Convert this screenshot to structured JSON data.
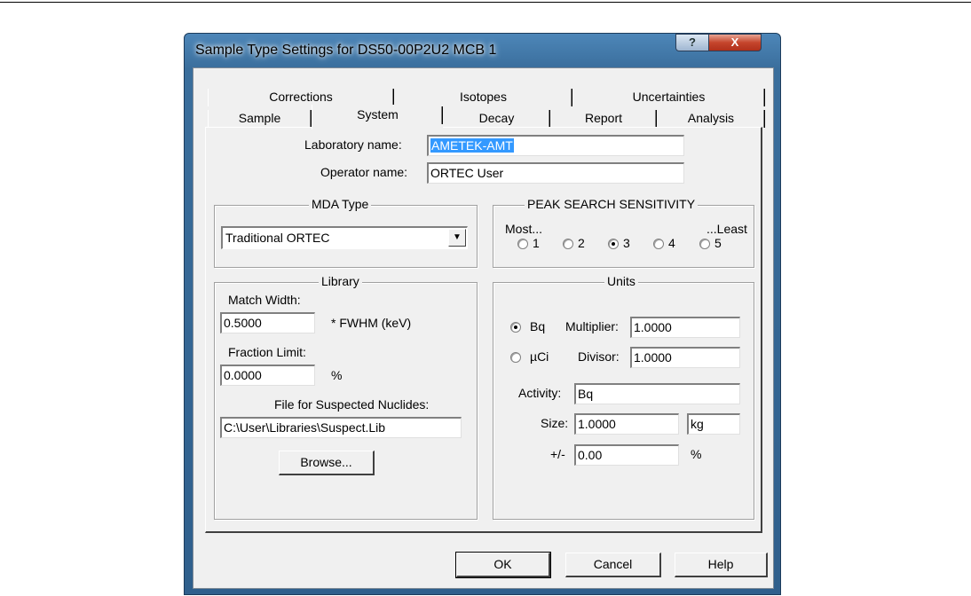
{
  "window": {
    "title": "Sample Type Settings for DS50-00P2U2 MCB 1",
    "help_icon": "?",
    "close_icon": "X"
  },
  "tabs": {
    "row1": [
      "Corrections",
      "Isotopes",
      "Uncertainties"
    ],
    "row2": [
      "Sample",
      "System",
      "Decay",
      "Report",
      "Analysis"
    ],
    "active": "System"
  },
  "system": {
    "lab_label": "Laboratory name:",
    "lab_value": "AMETEK-AMT",
    "operator_label": "Operator name:",
    "operator_value": "ORTEC User"
  },
  "mda": {
    "title": "MDA Type",
    "selected": "Traditional ORTEC",
    "arrow": "▼"
  },
  "peak": {
    "title": "PEAK SEARCH SENSITIVITY",
    "most": "Most...",
    "least": "...Least",
    "options": [
      "1",
      "2",
      "3",
      "4",
      "5"
    ],
    "selected": "3"
  },
  "library": {
    "title": "Library",
    "match_width_label": "Match Width:",
    "match_width_value": "0.5000",
    "match_width_unit": "* FWHM (keV)",
    "fraction_limit_label": "Fraction Limit:",
    "fraction_limit_value": "0.0000",
    "fraction_unit": "%",
    "suspect_label": "File for Suspected Nuclides:",
    "suspect_value": "C:\\User\\Libraries\\Suspect.Lib",
    "browse_label": "Browse..."
  },
  "units": {
    "title": "Units",
    "bq_label": "Bq",
    "uci_label": "µCi",
    "multiplier_label": "Multiplier:",
    "multiplier_value": "1.0000",
    "divisor_label": "Divisor:",
    "divisor_value": "1.0000",
    "activity_label": "Activity:",
    "activity_value": "Bq",
    "size_label": "Size:",
    "size_value": "1.0000",
    "size_unit": "kg",
    "pm_label": "+/-",
    "pm_value": "0.00",
    "pm_unit": "%",
    "selected": "Bq"
  },
  "buttons": {
    "ok": "OK",
    "cancel": "Cancel",
    "help": "Help"
  }
}
